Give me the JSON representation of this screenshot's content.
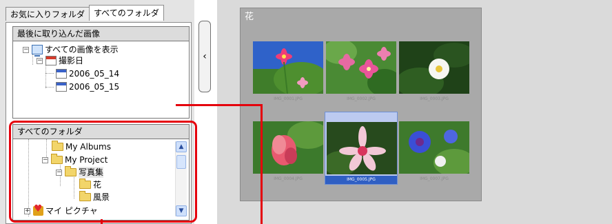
{
  "tabs": [
    {
      "label": "お気に入りフォルダ"
    },
    {
      "label": "すべてのフォルダ"
    }
  ],
  "recent_box": {
    "header": "最後に取り込んだ画像",
    "items": {
      "all_images": "すべての画像を表示",
      "shoot_date": "撮影日",
      "date1": "2006_05_14",
      "date2": "2006_05_15"
    }
  },
  "folders_box": {
    "header": "すべてのフォルダ",
    "items": {
      "my_albums": "My Albums",
      "my_project": "My Project",
      "photo_album": "写真集",
      "flower": "花",
      "landscape": "風景",
      "my_pictures": "マイ ピクチャ"
    }
  },
  "viewer": {
    "folder_title": "花",
    "thumbnails": [
      {
        "name": "IMG_0001.JPG",
        "selected": false
      },
      {
        "name": "IMG_0002.JPG",
        "selected": false
      },
      {
        "name": "IMG_0003.JPG",
        "selected": false
      },
      {
        "name": "IMG_0004.JPG",
        "selected": false
      },
      {
        "name": "IMG_0005.JPG",
        "selected": true
      },
      {
        "name": "IMG_0007.JPG",
        "selected": false
      }
    ]
  },
  "icons": {
    "collapse": "minus-expander-icon",
    "expand": "plus-expander-icon",
    "splitter": "chevron-left-icon",
    "scroll_up": "scroll-up-icon",
    "scroll_down": "scroll-down-icon"
  },
  "colors": {
    "highlight": "#e5000c",
    "selection": "#2f5fc3"
  }
}
